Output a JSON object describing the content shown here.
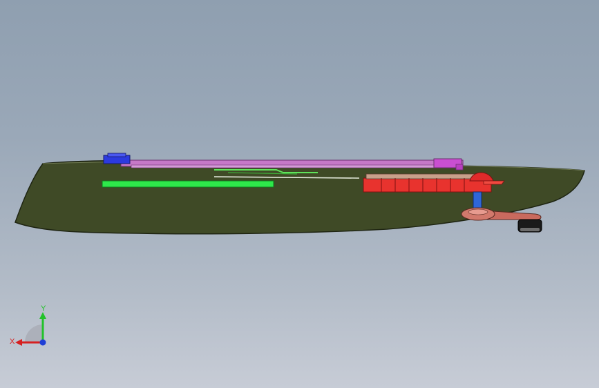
{
  "viewport": {
    "background_top": "#8f9fb0",
    "background_bottom": "#c7ccd6"
  },
  "model": {
    "hull_color": "#3f4a26",
    "hull_edge": "#1e2412",
    "rail_color": "#c678c8",
    "rail_edge": "#6b2f70",
    "green_bar_color": "#2ee84a",
    "red_block_color": "#e8332e",
    "blue_clamp_color": "#2c3adf",
    "pivot_color": "#2f66d8",
    "arm_color": "#c96a5e",
    "foot_color": "#1a1a1a"
  },
  "triad": {
    "x_label": "X",
    "y_label": "Y",
    "x_color": "#d62020",
    "y_color": "#22c22a",
    "z_color": "#1f3fd6"
  }
}
